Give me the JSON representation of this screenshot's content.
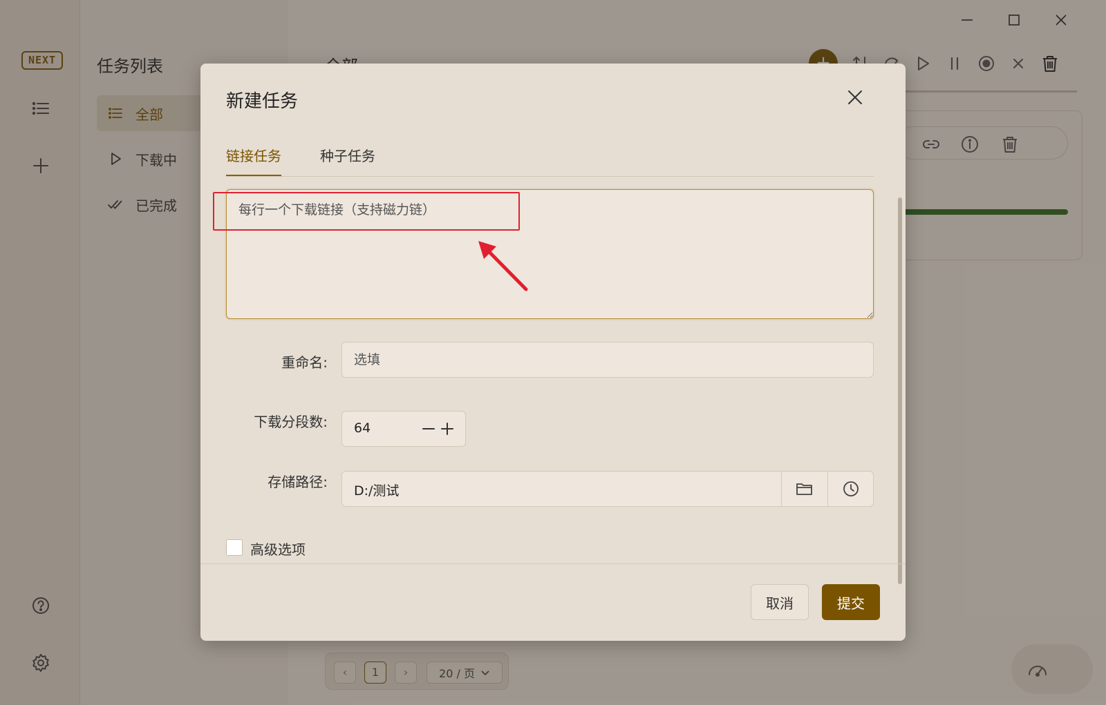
{
  "app": {
    "logo_text": "NEXT",
    "sidebar_title": "任务列表",
    "sidebar_items": [
      {
        "label": "全部",
        "icon": "list-icon"
      },
      {
        "label": "下载中",
        "icon": "play-icon"
      },
      {
        "label": "已完成",
        "icon": "double-check-icon"
      }
    ],
    "main_title": "全部",
    "pagination": {
      "current_page": "1",
      "page_size": "20 / 页"
    },
    "colors": {
      "accent": "#7a5300",
      "progress": "#2d6a1f",
      "annotation": "#e02030"
    }
  },
  "dialog": {
    "title": "新建任务",
    "tabs": [
      {
        "label": "链接任务",
        "active": true
      },
      {
        "label": "种子任务",
        "active": false
      }
    ],
    "links_placeholder": "每行一个下载链接（支持磁力链）",
    "rename": {
      "label": "重命名:",
      "placeholder": "选填"
    },
    "segments": {
      "label": "下载分段数:",
      "value": "64"
    },
    "path": {
      "label": "存储路径:",
      "value": "D:/测试"
    },
    "advanced_label": "高级选项",
    "cancel_label": "取消",
    "submit_label": "提交"
  }
}
